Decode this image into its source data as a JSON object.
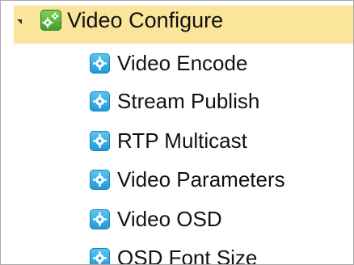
{
  "tree": {
    "root": {
      "label": "Video Configure",
      "icon": "gears-icon",
      "expanded": true,
      "highlight_color": "#fbe59a"
    },
    "children": [
      {
        "label": "Video Encode",
        "icon": "gear-icon"
      },
      {
        "label": "Stream Publish",
        "icon": "gear-icon"
      },
      {
        "label": "RTP Multicast",
        "icon": "gear-icon"
      },
      {
        "label": "Video Parameters",
        "icon": "gear-icon"
      },
      {
        "label": "Video OSD",
        "icon": "gear-icon"
      },
      {
        "label": "OSD Font Size",
        "icon": "gear-icon"
      }
    ]
  },
  "colors": {
    "root_icon": "#4caf34",
    "child_icon": "#2ba6e4"
  }
}
